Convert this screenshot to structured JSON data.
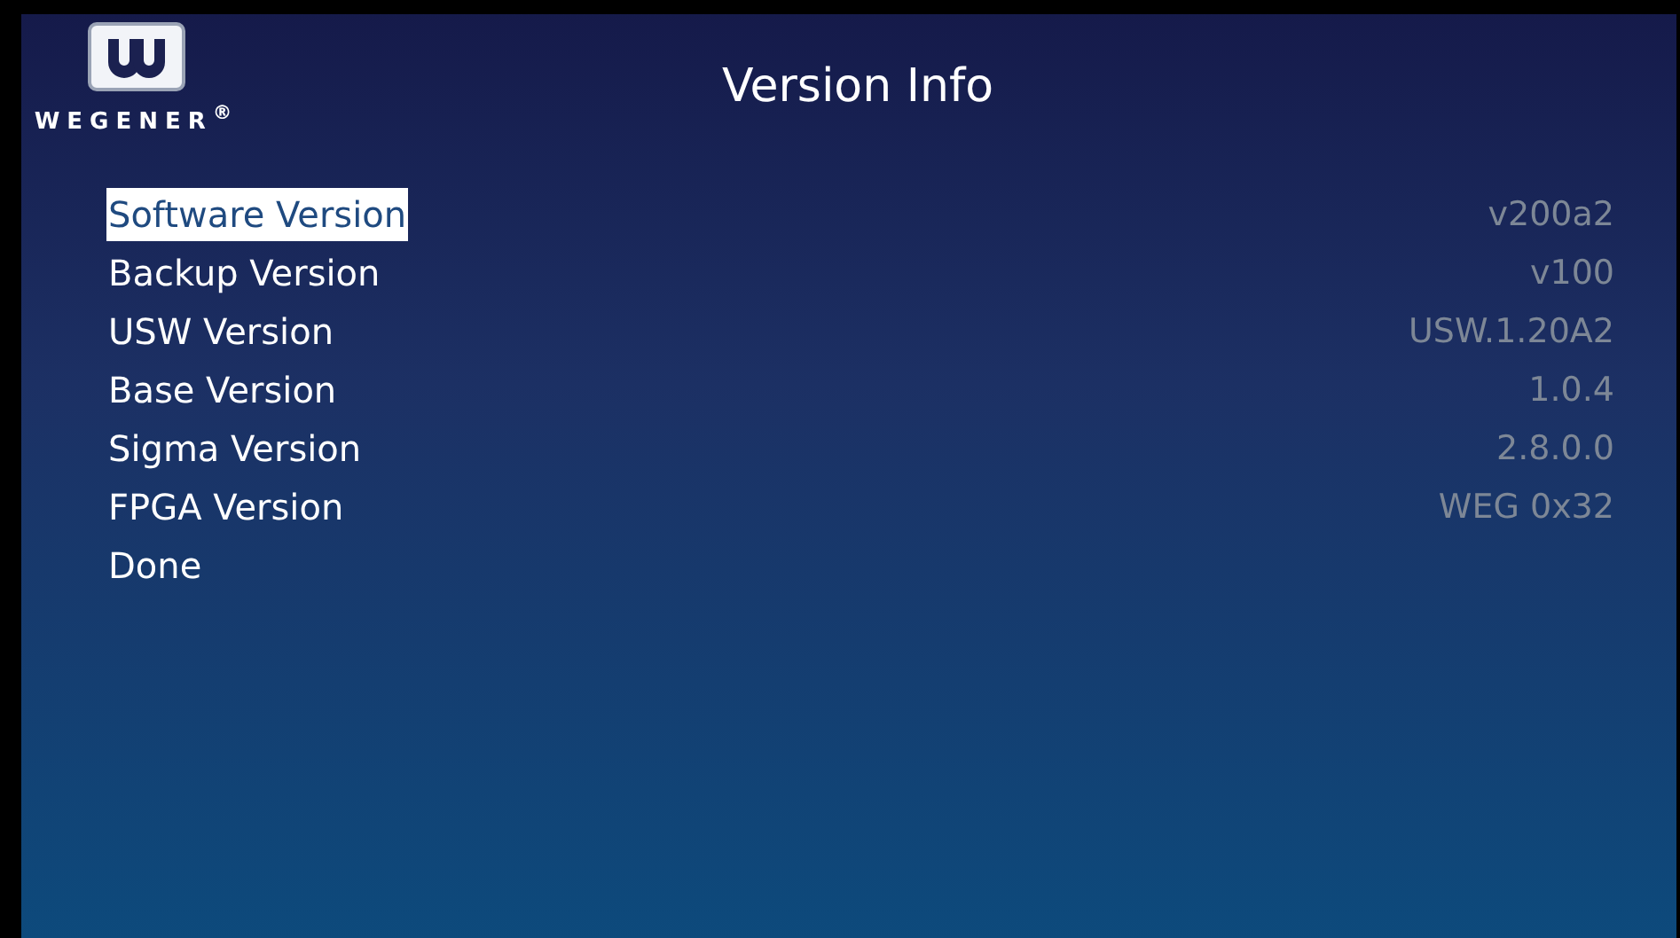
{
  "brand": {
    "name": "WEGENER$^{®}$"
  },
  "title": "Version Info",
  "items": [
    {
      "label": "Software Version",
      "value": "v200a2",
      "selected": true
    },
    {
      "label": "Backup Version",
      "value": "v100",
      "selected": false
    },
    {
      "label": "USW Version",
      "value": "USW.1.20A2",
      "selected": false
    },
    {
      "label": "Base Version",
      "value": "1.0.4",
      "selected": false
    },
    {
      "label": "Sigma Version",
      "value": "2.8.0.0",
      "selected": false
    },
    {
      "label": "FPGA Version",
      "value": "WEG 0x32",
      "selected": false
    },
    {
      "label": "Done",
      "selected": false
    }
  ]
}
